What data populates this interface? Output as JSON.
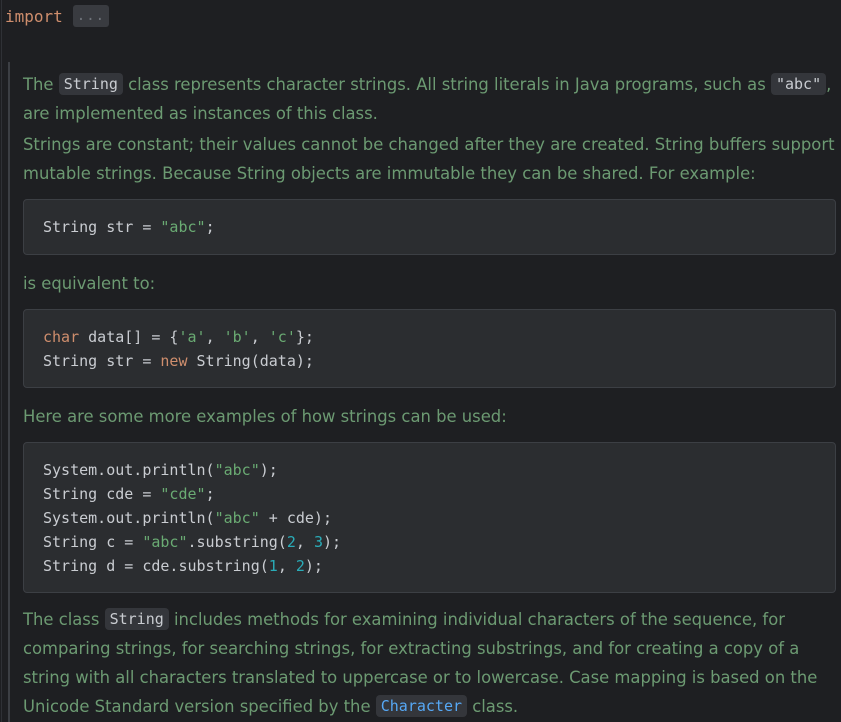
{
  "import_line": {
    "keyword": "import",
    "folded": "..."
  },
  "doc": {
    "p1": {
      "t1": "The ",
      "code1": "String",
      "t2": " class represents character strings. All string literals in Java programs, such as ",
      "code2": "\"abc\"",
      "t3": ", are implemented as instances of this class."
    },
    "p2": "Strings are constant; their values cannot be changed after they are created. String buffers support mutable strings. Because String objects are immutable they can be shared. For example:",
    "code_block_1": {
      "l1_a": "String str = ",
      "l1_s": "\"abc\"",
      "l1_b": ";"
    },
    "p3": "is equivalent to:",
    "code_block_2": {
      "l1_kw": "char",
      "l1_a": " data[] = {",
      "l1_s1": "'a'",
      "l1_b": ", ",
      "l1_s2": "'b'",
      "l1_c": ", ",
      "l1_s3": "'c'",
      "l1_d": "};",
      "l2_a": "String str = ",
      "l2_kw": "new",
      "l2_b": " String(data);"
    },
    "p4": "Here are some more examples of how strings can be used:",
    "code_block_3": {
      "l1_a": "System.out.println(",
      "l1_s": "\"abc\"",
      "l1_b": ");",
      "l2_a": "String cde = ",
      "l2_s": "\"cde\"",
      "l2_b": ";",
      "l3_a": "System.out.println(",
      "l3_s": "\"abc\"",
      "l3_b": " + cde);",
      "l4_a": "String c = ",
      "l4_s": "\"abc\"",
      "l4_b": ".substring(",
      "l4_n1": "2",
      "l4_c": ", ",
      "l4_n2": "3",
      "l4_d": ");",
      "l5_a": "String d = cde.substring(",
      "l5_n1": "1",
      "l5_b": ", ",
      "l5_n2": "2",
      "l5_c": ");"
    },
    "p5": {
      "t1": "The class ",
      "code1": "String",
      "t2": " includes methods for examining individual characters of the sequence, for comparing strings, for searching strings, for extracting substrings, and for creating a copy of a string with all characters translated to uppercase or to lowercase. Case mapping is based on the Unicode Standard version specified by the ",
      "code2": "Character",
      "t3": " class."
    }
  },
  "colors": {
    "background": "#1e1f22",
    "doc_text": "#6c9a72",
    "keyword": "#cf8e6d",
    "string_literal": "#6aab73",
    "number": "#2aacb8",
    "link": "#56a8f5",
    "code_block_bg": "#2b2d30"
  }
}
